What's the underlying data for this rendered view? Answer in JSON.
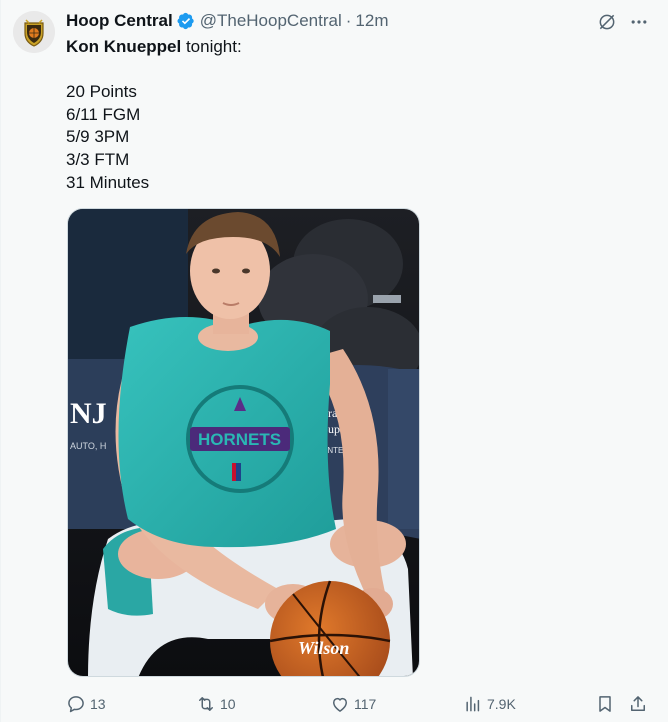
{
  "author": {
    "display_name": "Hoop Central",
    "handle": "@TheHoopCentral",
    "separator": "·",
    "time": "12m",
    "verified": true
  },
  "tweet": {
    "mention": "Kon Knueppel",
    "headline_rest": " tonight:",
    "stats": [
      "20 Points",
      "6/11 FGM",
      "5/9 3PM",
      "3/3 FTM",
      "31 Minutes"
    ]
  },
  "media": {
    "jersey_text": "HORNETS",
    "sign_left": "NJ",
    "sign_left_sub": "AUTO, H",
    "sign_right_1": "urance",
    "sign_right_2": "oup",
    "sign_right_3": "ENTERS.",
    "ball_brand": "Wilson"
  },
  "actions": {
    "replies": "13",
    "reposts": "10",
    "likes": "117",
    "views": "7.9K"
  },
  "icons": {
    "reply": "reply-icon",
    "repost": "repost-icon",
    "like": "heart-icon",
    "views": "views-icon",
    "bookmark": "bookmark-icon",
    "share": "share-icon",
    "grok": "grok-icon",
    "more": "more-icon",
    "verified": "verified-badge-icon"
  },
  "colors": {
    "verified_blue": "#1d9bf0",
    "secondary_text": "#536471",
    "jersey_teal": "#2ab7b4",
    "jersey_purple": "#4b2a7a"
  }
}
